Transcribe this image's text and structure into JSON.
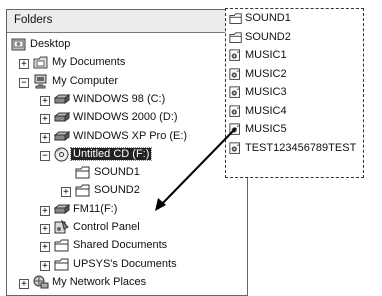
{
  "folders_pane": {
    "title": "Folders",
    "close": "×",
    "tree": [
      {
        "label": "Desktop",
        "icon": "desktop-icon",
        "level": 0,
        "expander": ""
      },
      {
        "label": "My Documents",
        "icon": "documents-folder-icon",
        "level": 1,
        "expander": "+"
      },
      {
        "label": "My Computer",
        "icon": "computer-icon",
        "level": 1,
        "expander": "−"
      },
      {
        "label": "WINDOWS 98 (C:)",
        "icon": "hard-drive-icon",
        "level": 2,
        "expander": "+"
      },
      {
        "label": "WINDOWS 2000 (D:)",
        "icon": "hard-drive-icon",
        "level": 2,
        "expander": "+"
      },
      {
        "label": "WINDOWS XP Pro (E:)",
        "icon": "hard-drive-icon",
        "level": 2,
        "expander": "+"
      },
      {
        "label": "Untitled CD (F:)",
        "icon": "cd-drive-icon",
        "level": 2,
        "expander": "−",
        "selected": true
      },
      {
        "label": "SOUND1",
        "icon": "folder-icon",
        "level": 3,
        "expander": ""
      },
      {
        "label": "SOUND2",
        "icon": "folder-icon",
        "level": 3,
        "expander": "+"
      },
      {
        "label": "FM11(F:)",
        "icon": "hard-drive-icon",
        "level": 2,
        "expander": "+"
      },
      {
        "label": "Control Panel",
        "icon": "control-panel-icon",
        "level": 2,
        "expander": "+"
      },
      {
        "label": "Shared Documents",
        "icon": "folder-icon",
        "level": 2,
        "expander": "+"
      },
      {
        "label": "UPSYS's Documents",
        "icon": "folder-icon",
        "level": 2,
        "expander": "+"
      },
      {
        "label": "My Network Places",
        "icon": "network-places-icon",
        "level": 1,
        "expander": "+"
      }
    ]
  },
  "contents": [
    {
      "label": "SOUND1",
      "icon": "folder-icon"
    },
    {
      "label": "SOUND2",
      "icon": "folder-icon"
    },
    {
      "label": "MUSIC1",
      "icon": "audio-file-icon"
    },
    {
      "label": "MUSIC2",
      "icon": "audio-file-icon"
    },
    {
      "label": "MUSIC3",
      "icon": "audio-file-icon"
    },
    {
      "label": "MUSIC4",
      "icon": "audio-file-icon"
    },
    {
      "label": "MUSIC5",
      "icon": "audio-file-icon"
    },
    {
      "label": "TEST123456789TEST",
      "icon": "audio-file-icon"
    }
  ],
  "colors": {
    "selection": "#222222",
    "border": "#666666",
    "header": "#ececec"
  }
}
